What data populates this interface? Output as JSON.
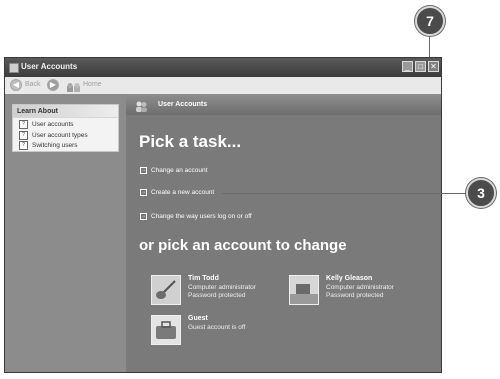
{
  "window": {
    "title": "User Accounts",
    "controls": {
      "minimize": "_",
      "maximize": "□",
      "close": "✕"
    }
  },
  "toolbar": {
    "back_label": "Back",
    "home_label": "Home"
  },
  "callouts": {
    "close": "7",
    "create": "3"
  },
  "sidebar": {
    "learn_about": {
      "heading": "Learn About",
      "items": [
        {
          "label": "User accounts",
          "icon": "help-icon"
        },
        {
          "label": "User account types",
          "icon": "help-icon"
        },
        {
          "label": "Switching users",
          "icon": "help-icon"
        }
      ]
    }
  },
  "main": {
    "header_title": "User Accounts",
    "pick_task_title": "Pick a task...",
    "tasks": [
      {
        "label": "Change an account"
      },
      {
        "label": "Create a new account"
      },
      {
        "label": "Change the way users log on or off"
      }
    ],
    "pick_account_title": "or pick an account to change",
    "accounts": [
      {
        "name": "Tim Todd",
        "line1": "Computer administrator",
        "line2": "Password protected",
        "picture": "guitar-picture"
      },
      {
        "name": "Kelly Gleason",
        "line1": "Computer administrator",
        "line2": "Password protected",
        "picture": "beach-chair-picture"
      },
      {
        "name": "Guest",
        "line1": "Guest account is off",
        "line2": "",
        "picture": "briefcase-picture"
      }
    ]
  }
}
